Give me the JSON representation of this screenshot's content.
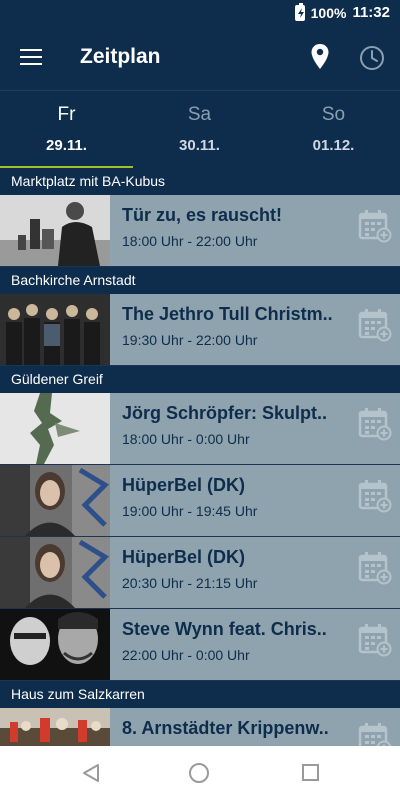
{
  "status_bar": {
    "battery_percent": "100%",
    "time": "11:32"
  },
  "app_bar": {
    "title": "Zeitplan",
    "menu_icon": "menu-icon",
    "location_icon": "location-pin-icon",
    "clock_icon": "clock-icon"
  },
  "day_tabs": [
    {
      "day": "Fr",
      "date": "29.11.",
      "selected": true
    },
    {
      "day": "Sa",
      "date": "30.11.",
      "selected": false
    },
    {
      "day": "So",
      "date": "01.12.",
      "selected": false
    }
  ],
  "sections": [
    {
      "venue": "Marktplatz mit BA-Kubus",
      "events": [
        {
          "title": "Tür zu, es rauscht!",
          "time": "18:00 Uhr - 22:00 Uhr"
        }
      ]
    },
    {
      "venue": "Bachkirche Arnstadt",
      "events": [
        {
          "title": "The Jethro Tull Christm..",
          "time": "19:30 Uhr - 22:00 Uhr"
        }
      ]
    },
    {
      "venue": "Güldener Greif",
      "events": [
        {
          "title": "Jörg Schröpfer: Skulpt..",
          "time": "18:00 Uhr - 0:00 Uhr"
        },
        {
          "title": "HüperBel (DK)",
          "time": "19:00 Uhr - 19:45 Uhr"
        },
        {
          "title": "HüperBel (DK)",
          "time": "20:30 Uhr - 21:15 Uhr"
        },
        {
          "title": "Steve Wynn feat. Chris..",
          "time": "22:00 Uhr - 0:00 Uhr"
        }
      ]
    },
    {
      "venue": "Haus zum Salzkarren",
      "events": [
        {
          "title": "8. Arnstädter Krippenw..",
          "time": ""
        }
      ]
    }
  ],
  "colors": {
    "primary": "#0e2c4b",
    "row_bg": "#8ea3ad",
    "tab_indicator": "#9fbf2c"
  }
}
